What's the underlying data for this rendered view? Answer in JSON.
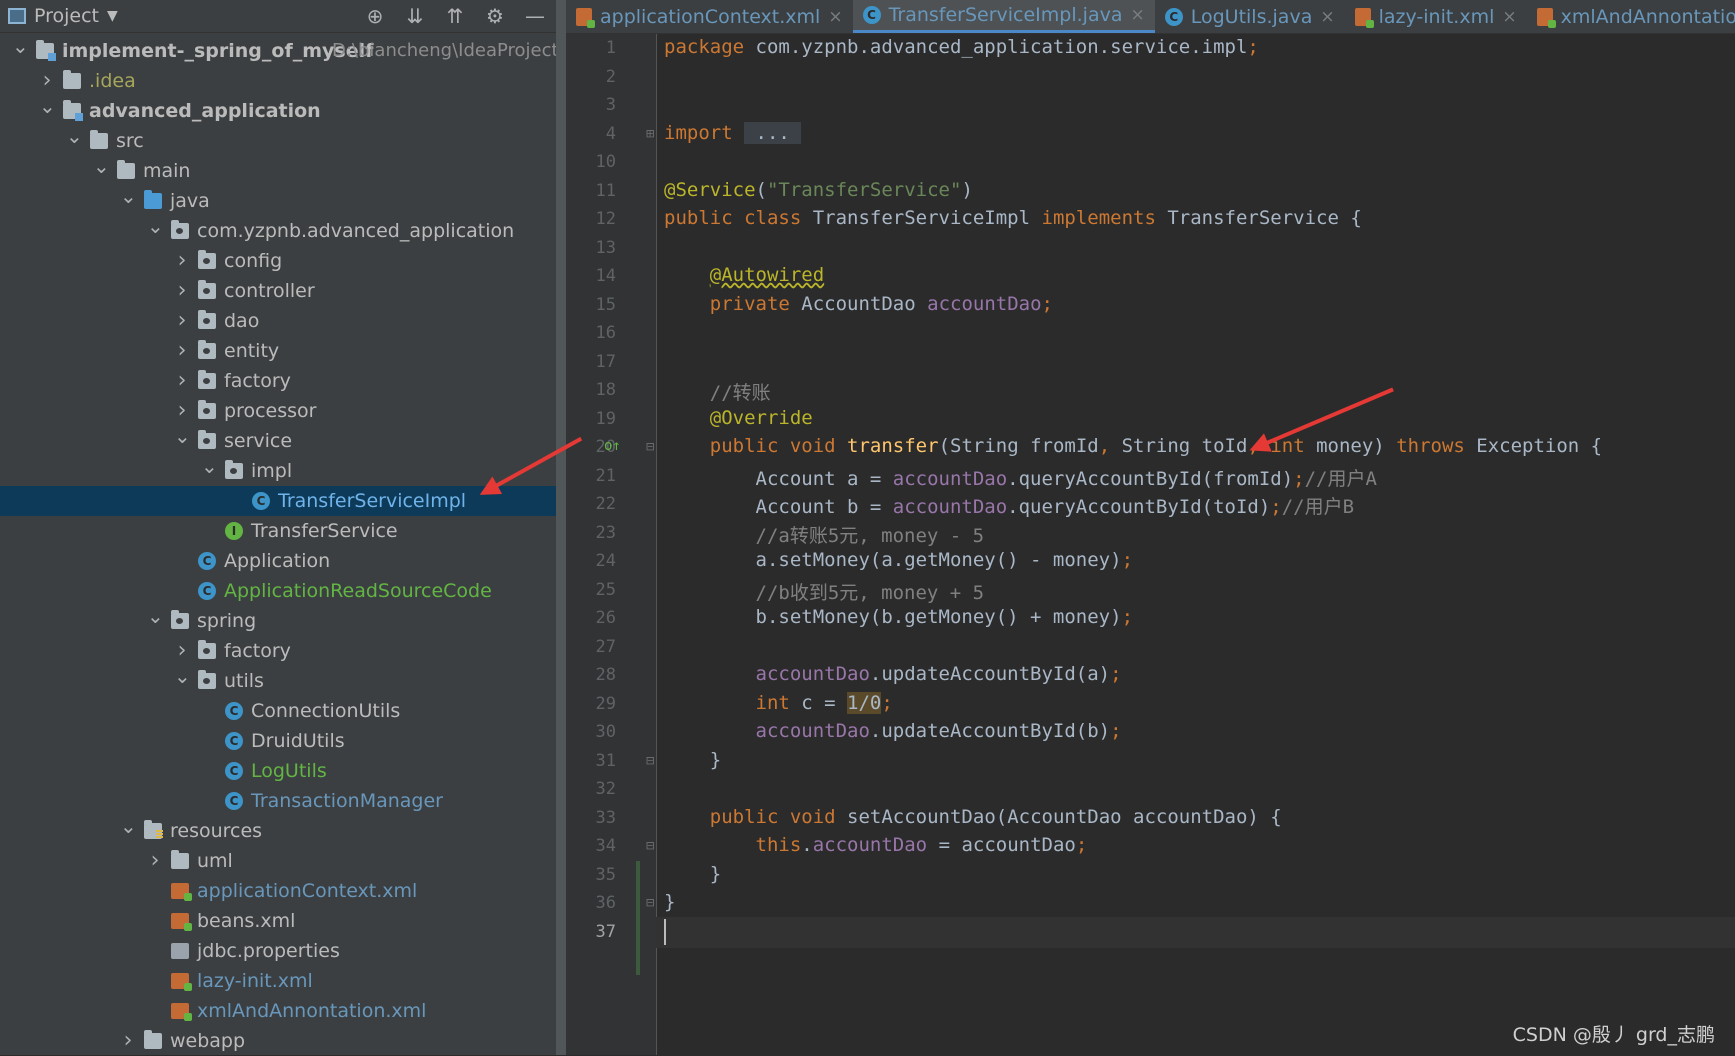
{
  "project_panel": {
    "title": "Project",
    "tool_icons": [
      "locate-icon",
      "expand-all-icon",
      "collapse-all-icon",
      "settings-icon",
      "minimize-icon"
    ]
  },
  "tree": [
    {
      "indent": 0,
      "chev": "v",
      "icon": "module",
      "label": "implement-_spring_of_myself",
      "extra": "D:\\biancheng\\IdeaProjects",
      "style": "bold white"
    },
    {
      "indent": 1,
      "chev": ">",
      "icon": "folder",
      "label": ".idea",
      "style": "olive"
    },
    {
      "indent": 1,
      "chev": "v",
      "icon": "module",
      "label": "advanced_application",
      "style": "bold white"
    },
    {
      "indent": 2,
      "chev": "v",
      "icon": "folder",
      "label": "src",
      "style": "white"
    },
    {
      "indent": 3,
      "chev": "v",
      "icon": "folder",
      "label": "main",
      "style": "white"
    },
    {
      "indent": 4,
      "chev": "v",
      "icon": "src",
      "label": "java",
      "style": "white"
    },
    {
      "indent": 5,
      "chev": "v",
      "icon": "pkg",
      "label": "com.yzpnb.advanced_application",
      "style": "white"
    },
    {
      "indent": 6,
      "chev": ">",
      "icon": "pkg",
      "label": "config",
      "style": "white"
    },
    {
      "indent": 6,
      "chev": ">",
      "icon": "pkg",
      "label": "controller",
      "style": "white"
    },
    {
      "indent": 6,
      "chev": ">",
      "icon": "pkg",
      "label": "dao",
      "style": "white"
    },
    {
      "indent": 6,
      "chev": ">",
      "icon": "pkg",
      "label": "entity",
      "style": "white"
    },
    {
      "indent": 6,
      "chev": ">",
      "icon": "pkg",
      "label": "factory",
      "style": "white"
    },
    {
      "indent": 6,
      "chev": ">",
      "icon": "pkg",
      "label": "processor",
      "style": "white"
    },
    {
      "indent": 6,
      "chev": "v",
      "icon": "pkg",
      "label": "service",
      "style": "white"
    },
    {
      "indent": 7,
      "chev": "v",
      "icon": "pkg",
      "label": "impl",
      "style": "white"
    },
    {
      "indent": 8,
      "chev": "",
      "icon": "class-c",
      "label": "TransferServiceImpl",
      "style": "selected",
      "selected": true
    },
    {
      "indent": 7,
      "chev": "",
      "icon": "class-i",
      "label": "TransferService",
      "style": "white"
    },
    {
      "indent": 6,
      "chev": "",
      "icon": "class-c",
      "label": "Application",
      "style": "white"
    },
    {
      "indent": 6,
      "chev": "",
      "icon": "class-c",
      "label": "ApplicationReadSourceCode",
      "style": "green"
    },
    {
      "indent": 5,
      "chev": "v",
      "icon": "pkg",
      "label": "spring",
      "style": "white"
    },
    {
      "indent": 6,
      "chev": ">",
      "icon": "pkg",
      "label": "factory",
      "style": "white"
    },
    {
      "indent": 6,
      "chev": "v",
      "icon": "pkg",
      "label": "utils",
      "style": "white"
    },
    {
      "indent": 7,
      "chev": "",
      "icon": "class-c",
      "label": "ConnectionUtils",
      "style": "white"
    },
    {
      "indent": 7,
      "chev": "",
      "icon": "class-c",
      "label": "DruidUtils",
      "style": "white"
    },
    {
      "indent": 7,
      "chev": "",
      "icon": "class-c",
      "label": "LogUtils",
      "style": "green"
    },
    {
      "indent": 7,
      "chev": "",
      "icon": "class-c",
      "label": "TransactionManager",
      "style": "blue"
    },
    {
      "indent": 4,
      "chev": "v",
      "icon": "res",
      "label": "resources",
      "style": "white"
    },
    {
      "indent": 5,
      "chev": ">",
      "icon": "folder",
      "label": "uml",
      "style": "white"
    },
    {
      "indent": 5,
      "chev": "",
      "icon": "xml",
      "label": "applicationContext.xml",
      "style": "blue"
    },
    {
      "indent": 5,
      "chev": "",
      "icon": "xml",
      "label": "beans.xml",
      "style": "white"
    },
    {
      "indent": 5,
      "chev": "",
      "icon": "prop",
      "label": "jdbc.properties",
      "style": "white"
    },
    {
      "indent": 5,
      "chev": "",
      "icon": "xml",
      "label": "lazy-init.xml",
      "style": "blue"
    },
    {
      "indent": 5,
      "chev": "",
      "icon": "xml",
      "label": "xmlAndAnnontation.xml",
      "style": "blue"
    },
    {
      "indent": 4,
      "chev": ">",
      "icon": "folder",
      "label": "webapp",
      "style": "white"
    }
  ],
  "tabs": [
    {
      "label": "applicationContext.xml",
      "icon": "xml",
      "active": false
    },
    {
      "label": "TransferServiceImpl.java",
      "icon": "c",
      "active": true
    },
    {
      "label": "LogUtils.java",
      "icon": "c",
      "active": false
    },
    {
      "label": "lazy-init.xml",
      "icon": "xml",
      "active": false
    },
    {
      "label": "xmlAndAnnontation.xml",
      "icon": "xml",
      "active": false
    }
  ],
  "code_lines": [
    {
      "n": "1",
      "tokens": [
        [
          "kw",
          "package "
        ],
        [
          "",
          "com.yzpnb.advanced_application.service.impl"
        ],
        [
          "semi",
          ";"
        ]
      ]
    },
    {
      "n": "2",
      "tokens": []
    },
    {
      "n": "3",
      "tokens": []
    },
    {
      "n": "4",
      "tokens": [
        [
          "kw",
          "import "
        ],
        [
          "hl",
          " ... "
        ]
      ]
    },
    {
      "n": "10",
      "tokens": []
    },
    {
      "n": "11",
      "tokens": [
        [
          "ann",
          "@Service"
        ],
        [
          "",
          "("
        ],
        [
          "str",
          "\"TransferService\""
        ],
        [
          "",
          ")"
        ]
      ]
    },
    {
      "n": "12",
      "tokens": [
        [
          "kw",
          "public class "
        ],
        [
          "",
          "TransferServiceImpl "
        ],
        [
          "kw",
          "implements "
        ],
        [
          "",
          "TransferService {"
        ]
      ]
    },
    {
      "n": "13",
      "tokens": []
    },
    {
      "n": "14",
      "tokens": [
        [
          "",
          "    "
        ],
        [
          "ann under",
          "@Autowired"
        ]
      ]
    },
    {
      "n": "15",
      "tokens": [
        [
          "",
          "    "
        ],
        [
          "kw",
          "private "
        ],
        [
          "",
          "AccountDao "
        ],
        [
          "fld",
          "accountDao"
        ],
        [
          "semi",
          ";"
        ]
      ]
    },
    {
      "n": "16",
      "tokens": []
    },
    {
      "n": "17",
      "tokens": []
    },
    {
      "n": "18",
      "tokens": [
        [
          "cmt",
          "    //转账"
        ]
      ]
    },
    {
      "n": "19",
      "tokens": [
        [
          "",
          "    "
        ],
        [
          "ann",
          "@Override"
        ]
      ]
    },
    {
      "n": "20",
      "tokens": [
        [
          "",
          "    "
        ],
        [
          "kw",
          "public void "
        ],
        [
          "fn",
          "transfer"
        ],
        [
          "",
          "(String fromId"
        ],
        [
          "semi",
          ", "
        ],
        [
          "",
          "String toId"
        ],
        [
          "semi",
          ", "
        ],
        [
          "kw",
          "int "
        ],
        [
          "",
          "money) "
        ],
        [
          "kw",
          "throws "
        ],
        [
          "",
          "Exception {"
        ]
      ]
    },
    {
      "n": "21",
      "tokens": [
        [
          "",
          "        Account a = "
        ],
        [
          "fld",
          "accountDao"
        ],
        [
          "",
          ".queryAccountById(fromId)"
        ],
        [
          "semi",
          ";"
        ],
        [
          "cmt",
          "//用户A"
        ]
      ]
    },
    {
      "n": "22",
      "tokens": [
        [
          "",
          "        Account b = "
        ],
        [
          "fld",
          "accountDao"
        ],
        [
          "",
          ".queryAccountById(toId)"
        ],
        [
          "semi",
          ";"
        ],
        [
          "cmt",
          "//用户B"
        ]
      ]
    },
    {
      "n": "23",
      "tokens": [
        [
          "cmt",
          "        //a转账5元, money - 5"
        ]
      ]
    },
    {
      "n": "24",
      "tokens": [
        [
          "",
          "        a.setMoney(a.getMoney() - money)"
        ],
        [
          "semi",
          ";"
        ]
      ]
    },
    {
      "n": "25",
      "tokens": [
        [
          "cmt",
          "        //b收到5元, money + 5"
        ]
      ]
    },
    {
      "n": "26",
      "tokens": [
        [
          "",
          "        b.setMoney(b.getMoney() + money)"
        ],
        [
          "semi",
          ";"
        ]
      ]
    },
    {
      "n": "27",
      "tokens": []
    },
    {
      "n": "28",
      "tokens": [
        [
          "",
          "        "
        ],
        [
          "fld",
          "accountDao"
        ],
        [
          "",
          ".updateAccountById(a)"
        ],
        [
          "semi",
          ";"
        ]
      ]
    },
    {
      "n": "29",
      "tokens": [
        [
          "",
          "        "
        ],
        [
          "kw",
          "int "
        ],
        [
          "",
          "c = "
        ],
        [
          "div0",
          "1/0"
        ],
        [
          "semi",
          ";"
        ]
      ]
    },
    {
      "n": "30",
      "tokens": [
        [
          "",
          "        "
        ],
        [
          "fld",
          "accountDao"
        ],
        [
          "",
          ".updateAccountById(b)"
        ],
        [
          "semi",
          ";"
        ]
      ]
    },
    {
      "n": "31",
      "tokens": [
        [
          "",
          "    }"
        ]
      ]
    },
    {
      "n": "32",
      "tokens": []
    },
    {
      "n": "33",
      "tokens": [
        [
          "",
          "    "
        ],
        [
          "kw",
          "public void "
        ],
        [
          "",
          "setAccountDao(AccountDao accountDao) {"
        ]
      ]
    },
    {
      "n": "34",
      "tokens": [
        [
          "",
          "        "
        ],
        [
          "kw",
          "this"
        ],
        [
          "",
          "."
        ],
        [
          "fld",
          "accountDao"
        ],
        [
          "",
          " = accountDao"
        ],
        [
          "semi",
          ";"
        ]
      ]
    },
    {
      "n": "35",
      "tokens": [
        [
          "",
          "    }"
        ]
      ]
    },
    {
      "n": "36",
      "tokens": [
        [
          "",
          "}"
        ]
      ]
    },
    {
      "n": "37",
      "tokens": []
    }
  ],
  "watermark": "CSDN @殷丿 grd_志鹏",
  "colors": {
    "selection": "#0d3a58",
    "keyword": "#cc7832",
    "string": "#6a8759",
    "annotation": "#bbb529",
    "field": "#9876aa",
    "method": "#ffc66d",
    "comment": "#808080",
    "arrow": "#e53935"
  }
}
